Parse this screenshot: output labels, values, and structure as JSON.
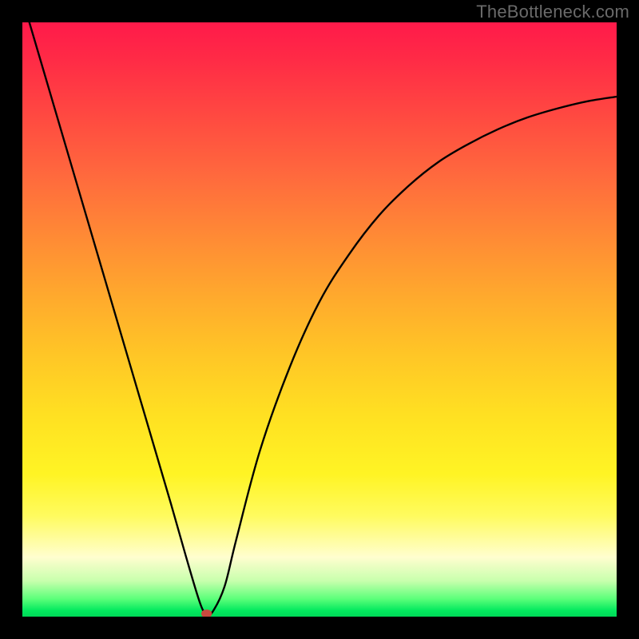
{
  "watermark": "TheBottleneck.com",
  "chart_data": {
    "type": "line",
    "title": "",
    "xlabel": "",
    "ylabel": "",
    "xlim": [
      0,
      100
    ],
    "ylim": [
      0,
      100
    ],
    "series": [
      {
        "name": "bottleneck-curve",
        "x": [
          0,
          5,
          10,
          15,
          20,
          25,
          28,
          30,
          31,
          32,
          34,
          36,
          40,
          45,
          50,
          55,
          60,
          65,
          70,
          75,
          80,
          85,
          90,
          95,
          100
        ],
        "values": [
          104,
          87,
          70,
          53,
          36,
          19,
          8.5,
          2,
          0.5,
          0.8,
          5,
          13,
          28,
          42,
          53,
          61,
          67.5,
          72.5,
          76.5,
          79.5,
          82,
          84,
          85.5,
          86.7,
          87.5
        ]
      }
    ],
    "marker": {
      "x": 31,
      "y": 0.5,
      "color": "#c94a3f"
    },
    "gradient_stops": [
      {
        "pos": 0,
        "color": "#ff1a4a"
      },
      {
        "pos": 50,
        "color": "#ffc626"
      },
      {
        "pos": 90,
        "color": "#fffecf"
      },
      {
        "pos": 100,
        "color": "#00d858"
      }
    ]
  }
}
